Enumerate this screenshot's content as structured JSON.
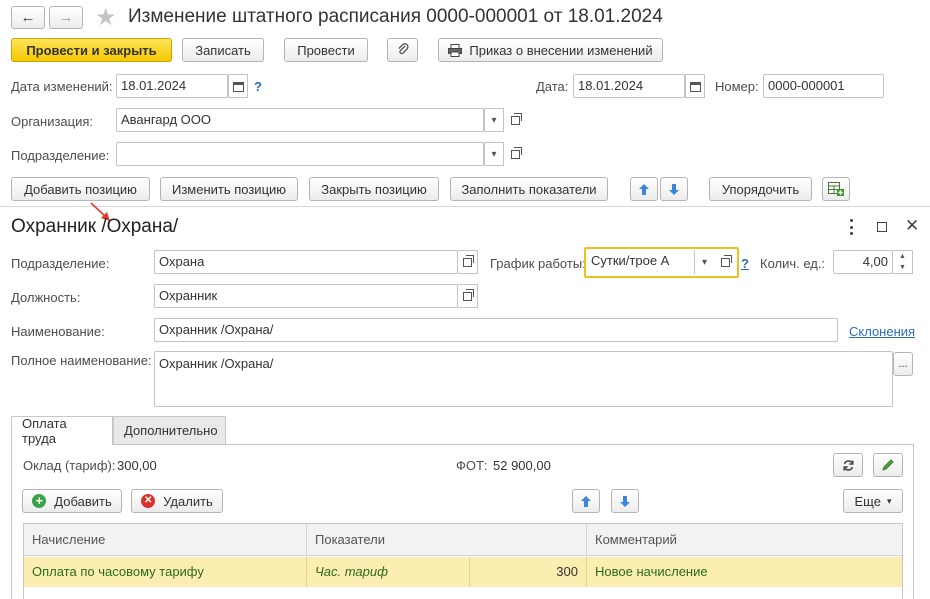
{
  "window": {
    "title": "Изменение штатного расписания 0000-000001 от 18.01.2024"
  },
  "toolbar": {
    "post_close": "Провести и закрыть",
    "save": "Записать",
    "post": "Провести",
    "order": "Приказ о внесении изменений"
  },
  "header": {
    "change_date_label": "Дата изменений:",
    "change_date_value": "18.01.2024",
    "date_label": "Дата:",
    "date_value": "18.01.2024",
    "number_label": "Номер:",
    "number_value": "0000-000001",
    "org_label": "Организация:",
    "org_value": "Авангард ООО",
    "dept_label": "Подразделение:",
    "dept_value": "",
    "help": "?"
  },
  "positions_toolbar": {
    "add": "Добавить позицию",
    "change": "Изменить позицию",
    "close": "Закрыть позицию",
    "fill": "Заполнить показатели",
    "sort": "Упорядочить"
  },
  "subform": {
    "title": "Охранник /Охрана/",
    "dept_label": "Подразделение:",
    "dept_value": "Охрана",
    "schedule_label": "График работы:",
    "schedule_value": "Сутки/трое А",
    "help": "?",
    "qty_label": "Колич. ед.:",
    "qty_value": "4,00",
    "position_label": "Должность:",
    "position_value": "Охранник",
    "name_label": "Наименование:",
    "name_value": "Охранник /Охрана/",
    "declension_link": "Склонения",
    "full_name_label": "Полное наименование:",
    "full_name_value": "Охранник /Охрана/",
    "more": "..."
  },
  "tabs": [
    {
      "label": "Оплата труда",
      "active": true
    },
    {
      "label": "Дополнительно",
      "active": false
    }
  ],
  "pay": {
    "salary_label": "Оклад (тариф):",
    "salary_value": "300,00",
    "fot_label": "ФОТ:",
    "fot_value": "52 900,00",
    "add": "Добавить",
    "delete": "Удалить",
    "more": "Еще"
  },
  "grid": {
    "columns": [
      "Начисление",
      "Показатели",
      "Комментарий"
    ],
    "rows": [
      {
        "accrual": "Оплата по часовому тарифу",
        "indicator": "Час. тариф",
        "indicator_value": "300",
        "comment": "Новое начисление"
      }
    ]
  },
  "colors": {
    "primary_button": "#f5c900",
    "row_highlight": "#fbeeb0",
    "focus_border": "#f0c020",
    "link": "#2a6fbd"
  }
}
